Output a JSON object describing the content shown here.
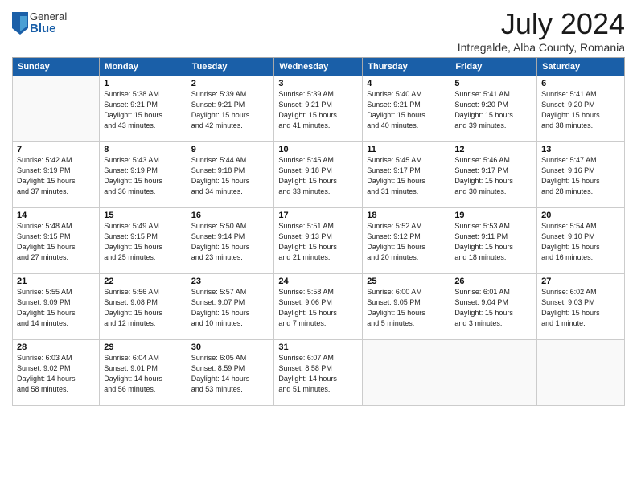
{
  "header": {
    "logo_general": "General",
    "logo_blue": "Blue",
    "title": "July 2024",
    "location": "Intregalde, Alba County, Romania"
  },
  "days_of_week": [
    "Sunday",
    "Monday",
    "Tuesday",
    "Wednesday",
    "Thursday",
    "Friday",
    "Saturday"
  ],
  "weeks": [
    [
      {
        "day": "",
        "info": ""
      },
      {
        "day": "1",
        "info": "Sunrise: 5:38 AM\nSunset: 9:21 PM\nDaylight: 15 hours\nand 43 minutes."
      },
      {
        "day": "2",
        "info": "Sunrise: 5:39 AM\nSunset: 9:21 PM\nDaylight: 15 hours\nand 42 minutes."
      },
      {
        "day": "3",
        "info": "Sunrise: 5:39 AM\nSunset: 9:21 PM\nDaylight: 15 hours\nand 41 minutes."
      },
      {
        "day": "4",
        "info": "Sunrise: 5:40 AM\nSunset: 9:21 PM\nDaylight: 15 hours\nand 40 minutes."
      },
      {
        "day": "5",
        "info": "Sunrise: 5:41 AM\nSunset: 9:20 PM\nDaylight: 15 hours\nand 39 minutes."
      },
      {
        "day": "6",
        "info": "Sunrise: 5:41 AM\nSunset: 9:20 PM\nDaylight: 15 hours\nand 38 minutes."
      }
    ],
    [
      {
        "day": "7",
        "info": "Sunrise: 5:42 AM\nSunset: 9:19 PM\nDaylight: 15 hours\nand 37 minutes."
      },
      {
        "day": "8",
        "info": "Sunrise: 5:43 AM\nSunset: 9:19 PM\nDaylight: 15 hours\nand 36 minutes."
      },
      {
        "day": "9",
        "info": "Sunrise: 5:44 AM\nSunset: 9:18 PM\nDaylight: 15 hours\nand 34 minutes."
      },
      {
        "day": "10",
        "info": "Sunrise: 5:45 AM\nSunset: 9:18 PM\nDaylight: 15 hours\nand 33 minutes."
      },
      {
        "day": "11",
        "info": "Sunrise: 5:45 AM\nSunset: 9:17 PM\nDaylight: 15 hours\nand 31 minutes."
      },
      {
        "day": "12",
        "info": "Sunrise: 5:46 AM\nSunset: 9:17 PM\nDaylight: 15 hours\nand 30 minutes."
      },
      {
        "day": "13",
        "info": "Sunrise: 5:47 AM\nSunset: 9:16 PM\nDaylight: 15 hours\nand 28 minutes."
      }
    ],
    [
      {
        "day": "14",
        "info": "Sunrise: 5:48 AM\nSunset: 9:15 PM\nDaylight: 15 hours\nand 27 minutes."
      },
      {
        "day": "15",
        "info": "Sunrise: 5:49 AM\nSunset: 9:15 PM\nDaylight: 15 hours\nand 25 minutes."
      },
      {
        "day": "16",
        "info": "Sunrise: 5:50 AM\nSunset: 9:14 PM\nDaylight: 15 hours\nand 23 minutes."
      },
      {
        "day": "17",
        "info": "Sunrise: 5:51 AM\nSunset: 9:13 PM\nDaylight: 15 hours\nand 21 minutes."
      },
      {
        "day": "18",
        "info": "Sunrise: 5:52 AM\nSunset: 9:12 PM\nDaylight: 15 hours\nand 20 minutes."
      },
      {
        "day": "19",
        "info": "Sunrise: 5:53 AM\nSunset: 9:11 PM\nDaylight: 15 hours\nand 18 minutes."
      },
      {
        "day": "20",
        "info": "Sunrise: 5:54 AM\nSunset: 9:10 PM\nDaylight: 15 hours\nand 16 minutes."
      }
    ],
    [
      {
        "day": "21",
        "info": "Sunrise: 5:55 AM\nSunset: 9:09 PM\nDaylight: 15 hours\nand 14 minutes."
      },
      {
        "day": "22",
        "info": "Sunrise: 5:56 AM\nSunset: 9:08 PM\nDaylight: 15 hours\nand 12 minutes."
      },
      {
        "day": "23",
        "info": "Sunrise: 5:57 AM\nSunset: 9:07 PM\nDaylight: 15 hours\nand 10 minutes."
      },
      {
        "day": "24",
        "info": "Sunrise: 5:58 AM\nSunset: 9:06 PM\nDaylight: 15 hours\nand 7 minutes."
      },
      {
        "day": "25",
        "info": "Sunrise: 6:00 AM\nSunset: 9:05 PM\nDaylight: 15 hours\nand 5 minutes."
      },
      {
        "day": "26",
        "info": "Sunrise: 6:01 AM\nSunset: 9:04 PM\nDaylight: 15 hours\nand 3 minutes."
      },
      {
        "day": "27",
        "info": "Sunrise: 6:02 AM\nSunset: 9:03 PM\nDaylight: 15 hours\nand 1 minute."
      }
    ],
    [
      {
        "day": "28",
        "info": "Sunrise: 6:03 AM\nSunset: 9:02 PM\nDaylight: 14 hours\nand 58 minutes."
      },
      {
        "day": "29",
        "info": "Sunrise: 6:04 AM\nSunset: 9:01 PM\nDaylight: 14 hours\nand 56 minutes."
      },
      {
        "day": "30",
        "info": "Sunrise: 6:05 AM\nSunset: 8:59 PM\nDaylight: 14 hours\nand 53 minutes."
      },
      {
        "day": "31",
        "info": "Sunrise: 6:07 AM\nSunset: 8:58 PM\nDaylight: 14 hours\nand 51 minutes."
      },
      {
        "day": "",
        "info": ""
      },
      {
        "day": "",
        "info": ""
      },
      {
        "day": "",
        "info": ""
      }
    ]
  ]
}
